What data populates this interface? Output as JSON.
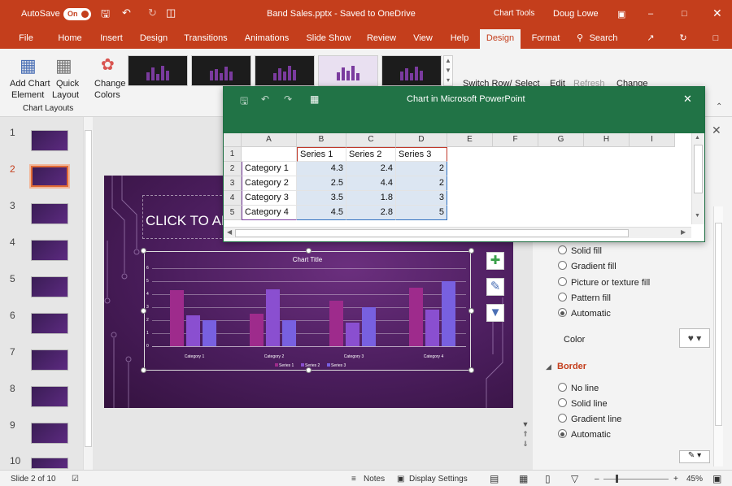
{
  "titlebar": {
    "autosave_label": "AutoSave",
    "autosave_state": "On",
    "file_title": "Band Sales.pptx - Saved to OneDrive",
    "context_label": "Chart Tools",
    "user": "Doug Lowe"
  },
  "tabs": [
    "File",
    "Home",
    "Insert",
    "Design",
    "Transitions",
    "Animations",
    "Slide Show",
    "Review",
    "View",
    "Help",
    "Design",
    "Format"
  ],
  "search_label": "Search",
  "ribbon": {
    "add_chart_element": [
      "Add Chart",
      "Element"
    ],
    "quick_layout": [
      "Quick",
      "Layout"
    ],
    "change_colors": [
      "Change",
      "Colors"
    ],
    "group_chart_layouts": "Chart Layouts",
    "switch_row": "Switch Row/",
    "select": "Select",
    "edit": "Edit",
    "refresh": "Refresh",
    "change": "Change"
  },
  "slides": {
    "numbers": [
      "1",
      "2",
      "3",
      "4",
      "5",
      "6",
      "7",
      "8",
      "9",
      "10"
    ],
    "selected": "2"
  },
  "slide": {
    "placeholder_text": "CLICK TO AD",
    "chart": {
      "title": "Chart Title",
      "y_ticks": [
        "6",
        "5",
        "4",
        "3",
        "2",
        "1",
        "0"
      ],
      "legend": [
        "Series 1",
        "Series 2",
        "Series 3"
      ]
    }
  },
  "chart_data": {
    "type": "bar",
    "title": "Chart Title",
    "categories": [
      "Category 1",
      "Category 2",
      "Category 3",
      "Category 4"
    ],
    "series": [
      {
        "name": "Series 1",
        "values": [
          4.3,
          2.5,
          3.5,
          4.5
        ]
      },
      {
        "name": "Series 2",
        "values": [
          2.4,
          4.4,
          1.8,
          2.8
        ]
      },
      {
        "name": "Series 3",
        "values": [
          2,
          2,
          3,
          5
        ]
      }
    ],
    "ylim": [
      0,
      6
    ],
    "grid": true,
    "legend_placement": "bottom",
    "colors": [
      "#9e2b8c",
      "#8a4fd0",
      "#7860e0"
    ]
  },
  "excel": {
    "title": "Chart in Microsoft PowerPoint",
    "columns": [
      "A",
      "B",
      "C",
      "D",
      "E",
      "F",
      "G",
      "H",
      "I"
    ],
    "rows": [
      "1",
      "2",
      "3",
      "4",
      "5"
    ],
    "header_row": [
      "",
      "Series 1",
      "Series 2",
      "Series 3"
    ],
    "data_rows": [
      [
        "Category 1",
        "4.3",
        "2.4",
        "2"
      ],
      [
        "Category 2",
        "2.5",
        "4.4",
        "2"
      ],
      [
        "Category 3",
        "3.5",
        "1.8",
        "3"
      ],
      [
        "Category 4",
        "4.5",
        "2.8",
        "5"
      ]
    ]
  },
  "format_pane": {
    "fill_options": [
      "Solid fill",
      "Gradient fill",
      "Picture or texture fill",
      "Pattern fill",
      "Automatic"
    ],
    "fill_selected": "Automatic",
    "color_label": "Color",
    "border_header": "Border",
    "border_options": [
      "No line",
      "Solid line",
      "Gradient line",
      "Automatic"
    ],
    "border_selected": "Automatic"
  },
  "statusbar": {
    "slide_info": "Slide 2 of 10",
    "notes": "Notes",
    "display_settings": "Display Settings",
    "zoom": "45%"
  }
}
